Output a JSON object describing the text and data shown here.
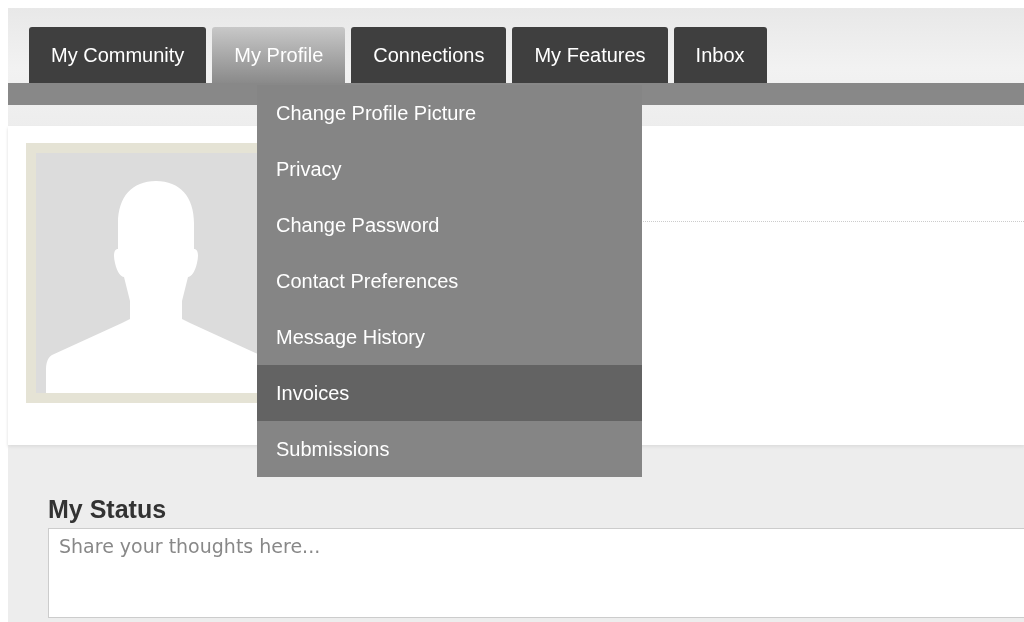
{
  "tabs": [
    {
      "label": "My Community",
      "selected": false
    },
    {
      "label": "My Profile",
      "selected": true
    },
    {
      "label": "Connections",
      "selected": false
    },
    {
      "label": "My Features",
      "selected": false
    },
    {
      "label": "Inbox",
      "selected": false
    }
  ],
  "dropdown": {
    "items": [
      {
        "label": "Change Profile Picture",
        "selected": false
      },
      {
        "label": "Privacy",
        "selected": false
      },
      {
        "label": "Change Password",
        "selected": false
      },
      {
        "label": "Contact Preferences",
        "selected": false
      },
      {
        "label": "Message History",
        "selected": false
      },
      {
        "label": "Invoices",
        "selected": true
      },
      {
        "label": "Submissions",
        "selected": false
      }
    ]
  },
  "status": {
    "heading": "My Status",
    "placeholder": "Share your thoughts here..."
  }
}
